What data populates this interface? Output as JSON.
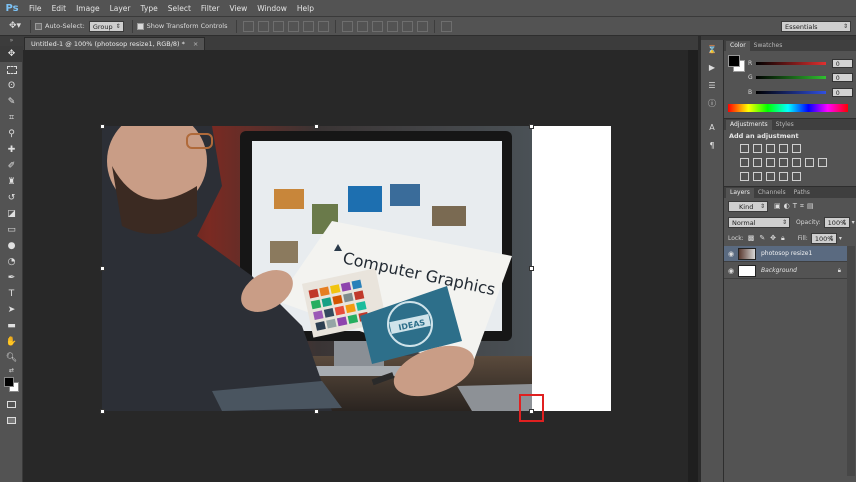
{
  "app": {
    "logo": "Ps",
    "menu": [
      "File",
      "Edit",
      "Image",
      "Layer",
      "Type",
      "Select",
      "Filter",
      "View",
      "Window",
      "Help"
    ]
  },
  "options_bar": {
    "auto_select_label": "Auto-Select:",
    "auto_select_value": "Group",
    "show_transform_label": "Show Transform Controls",
    "workspace": "Essentials"
  },
  "document": {
    "tab_title": "Untitled-1 @ 100% (photosop resize1, RGB/8) *",
    "close_glyph": "×"
  },
  "photo": {
    "headline": "Computer Graphics",
    "badge": "IDEAS"
  },
  "color_panel": {
    "tabs": [
      "Color",
      "Swatches"
    ],
    "channels": [
      {
        "label": "R",
        "value": "0",
        "color": "#e03030"
      },
      {
        "label": "G",
        "value": "0",
        "color": "#30c030"
      },
      {
        "label": "B",
        "value": "0",
        "color": "#3050e0"
      }
    ]
  },
  "adjustments_panel": {
    "tabs": [
      "Adjustments",
      "Styles"
    ],
    "heading": "Add an adjustment"
  },
  "layers_panel": {
    "tabs": [
      "Layers",
      "Channels",
      "Paths"
    ],
    "filter": "Kind",
    "blend_mode": "Normal",
    "opacity_label": "Opacity:",
    "opacity_value": "100%",
    "lock_label": "Lock:",
    "fill_label": "Fill:",
    "fill_value": "100%",
    "layers": [
      {
        "name": "photosop resize1",
        "selected": true
      },
      {
        "name": "Background",
        "selected": false
      }
    ]
  },
  "colors": {
    "accent_highlight": "#e02020",
    "selected_layer": "#5a6a80"
  }
}
